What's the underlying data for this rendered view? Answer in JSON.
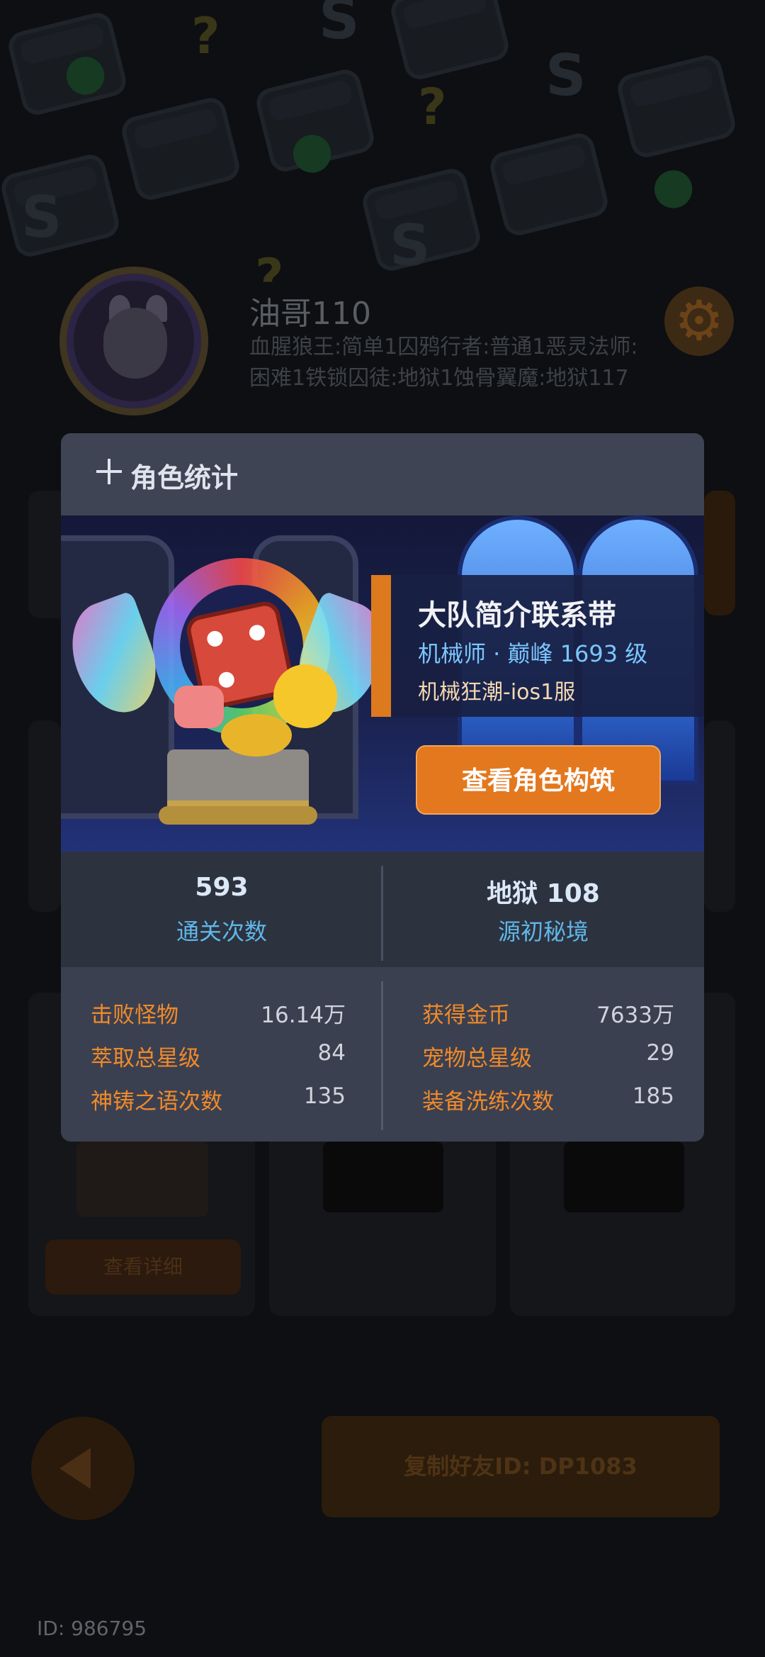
{
  "player": {
    "name": "油哥110",
    "description": "血腥狼王:简单1囚鸦行者:普通1恶灵法师:困难1铁锁囚徒:地狱1蚀骨翼魔:地狱117",
    "id_label": "ID: 986795"
  },
  "background": {
    "detail_button": "查看详细",
    "copy_button": "复制好友ID: DP1083"
  },
  "modal": {
    "title": "角色统计",
    "team_name": "大队简介联系带",
    "job_line": "机械师 · 巅峰 1693 级",
    "server_line": "机械狂潮-ios1服",
    "build_button": "查看角色构筑",
    "summary": [
      {
        "value": "593",
        "label": "通关次数"
      },
      {
        "value": "地狱 108",
        "label": "源初秘境"
      }
    ],
    "stats_left": [
      {
        "label": "击败怪物",
        "value": "16.14万"
      },
      {
        "label": "萃取总星级",
        "value": "84"
      },
      {
        "label": "神铸之语次数",
        "value": "135"
      }
    ],
    "stats_right": [
      {
        "label": "获得金币",
        "value": "7633万"
      },
      {
        "label": "宠物总星级",
        "value": "29"
      },
      {
        "label": "装备洗练次数",
        "value": "185"
      }
    ]
  },
  "colors": {
    "accent_orange": "#e3781f",
    "stat_label_orange": "#f08a2a",
    "summary_blue": "#5fb7e8",
    "modal_bg": "#3b4050"
  },
  "icons": [
    "plus-icon",
    "gear-icon",
    "back-arrow-icon"
  ]
}
